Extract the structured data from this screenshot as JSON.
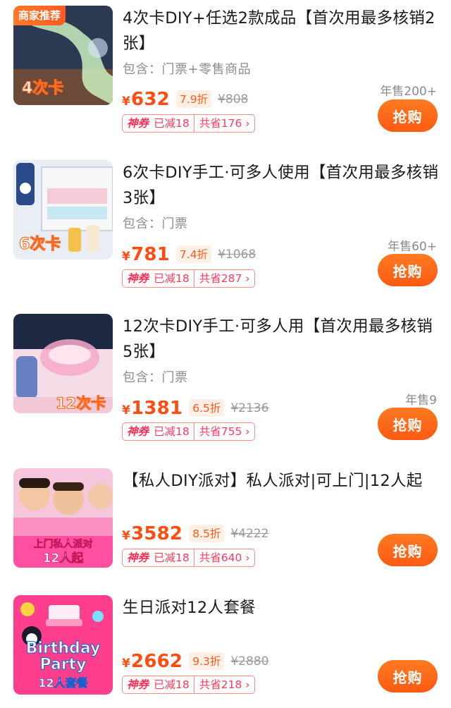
{
  "products": [
    {
      "merchant_tag": "商家推荐",
      "title": "4次卡DIY+任选2款成品【首次用最多核销2张】",
      "includes": "包含：门票+零售商品",
      "sold": "年售200+",
      "price": "632",
      "discount": "7.9折",
      "original_price": "¥808",
      "coupon_tag": "神券",
      "coupon_used": "已减18",
      "savings": "共省176 ›",
      "buy_label": "抢购",
      "thumb_caption": "4次卡",
      "thumb_colors": {
        "bg": "#2b3a52",
        "accent": "#c9f0c0"
      }
    },
    {
      "merchant_tag": "",
      "title": "6次卡DIY手工·可多人使用【首次用最多核销3张】",
      "includes": "包含：门票",
      "sold": "年售60+",
      "price": "781",
      "discount": "7.4折",
      "original_price": "¥1068",
      "coupon_tag": "神券",
      "coupon_used": "已减18",
      "savings": "共省287 ›",
      "buy_label": "抢购",
      "thumb_caption": "6次卡",
      "thumb_colors": {
        "bg": "#e9eef4",
        "accent": "#f2c24a"
      }
    },
    {
      "merchant_tag": "",
      "title": "12次卡DIY手工·可多人用【首次用最多核销5张】",
      "includes": "包含：门票",
      "sold": "年售9",
      "price": "1381",
      "discount": "6.5折",
      "original_price": "¥2136",
      "coupon_tag": "神券",
      "coupon_used": "已减18",
      "savings": "共省755 ›",
      "buy_label": "抢购",
      "thumb_caption": "12次卡",
      "thumb_colors": {
        "bg": "#f4dde6",
        "accent": "#f7a8c8"
      }
    },
    {
      "merchant_tag": "",
      "title": "【私人DIY派对】私人派对|可上门|12人起",
      "includes": "",
      "sold": "",
      "price": "3582",
      "discount": "8.5折",
      "original_price": "¥4222",
      "coupon_tag": "神券",
      "coupon_used": "已减18",
      "savings": "共省640 ›",
      "buy_label": "抢购",
      "thumb_caption_1": "上门私人派对",
      "thumb_caption_2": "12人起",
      "thumb_colors": {
        "bg": "#f6c6dc",
        "accent": "#ff4fa0"
      }
    },
    {
      "merchant_tag": "",
      "title": "生日派对12人套餐",
      "includes": "",
      "sold": "",
      "price": "2662",
      "discount": "9.3折",
      "original_price": "¥2880",
      "coupon_tag": "神券",
      "coupon_used": "已减18",
      "savings": "共省218 ›",
      "buy_label": "抢购",
      "thumb_caption_1": "Birthday",
      "thumb_caption_2": "Party",
      "thumb_caption_3": "12人套餐",
      "thumb_colors": {
        "bg": "#ff3f8e",
        "accent": "#ffd23f"
      }
    }
  ],
  "currency_symbol": "¥"
}
